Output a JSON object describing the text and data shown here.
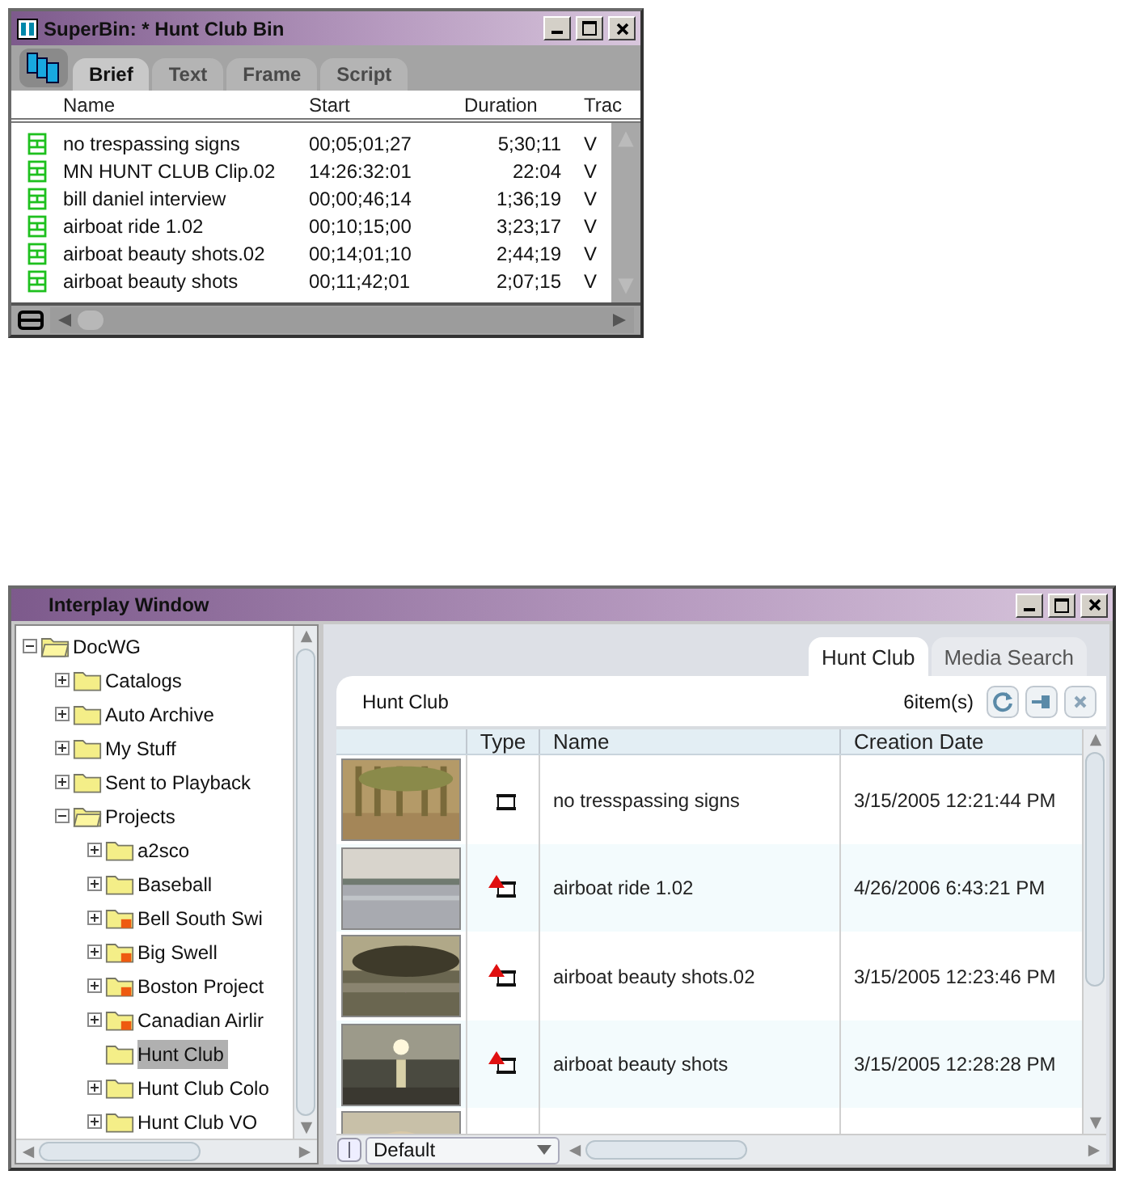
{
  "superbin": {
    "title": "SuperBin: * Hunt Club Bin",
    "tabs": [
      {
        "label": "Brief",
        "selected": true
      },
      {
        "label": "Text",
        "selected": false
      },
      {
        "label": "Frame",
        "selected": false
      },
      {
        "label": "Script",
        "selected": false
      }
    ],
    "columns": [
      "Name",
      "Start",
      "Duration",
      "Trac"
    ],
    "rows": [
      {
        "name": "no trespassing signs",
        "start": "00;05;01;27",
        "duration": "5;30;11",
        "track": "V"
      },
      {
        "name": "MN HUNT CLUB Clip.02",
        "start": "14:26:32:01",
        "duration": "22:04",
        "track": "V"
      },
      {
        "name": "bill daniel interview",
        "start": "00;00;46;14",
        "duration": "1;36;19",
        "track": "V"
      },
      {
        "name": "airboat ride 1.02",
        "start": "00;10;15;00",
        "duration": "3;23;17",
        "track": "V"
      },
      {
        "name": "airboat beauty shots.02",
        "start": "00;14;01;10",
        "duration": "2;44;19",
        "track": "V"
      },
      {
        "name": "airboat beauty shots",
        "start": "00;11;42;01",
        "duration": "2;07;15",
        "track": "V"
      }
    ]
  },
  "interplay": {
    "title": "Interplay Window",
    "tree": [
      {
        "label": "DocWG",
        "expanded": true,
        "selected": false,
        "marked": false,
        "children": [
          {
            "label": "Catalogs",
            "expanded": false,
            "selected": false,
            "marked": false
          },
          {
            "label": "Auto Archive",
            "expanded": false,
            "selected": false,
            "marked": false
          },
          {
            "label": "My Stuff",
            "expanded": false,
            "selected": false,
            "marked": false
          },
          {
            "label": "Sent to Playback",
            "expanded": false,
            "selected": false,
            "marked": false
          },
          {
            "label": "Projects",
            "expanded": true,
            "selected": false,
            "marked": false,
            "children": [
              {
                "label": "a2sco",
                "expanded": false,
                "selected": false,
                "marked": false
              },
              {
                "label": "Baseball",
                "expanded": false,
                "selected": false,
                "marked": false
              },
              {
                "label": "Bell South Swi",
                "expanded": false,
                "selected": false,
                "marked": true
              },
              {
                "label": "Big Swell",
                "expanded": false,
                "selected": false,
                "marked": true
              },
              {
                "label": "Boston Project",
                "expanded": false,
                "selected": false,
                "marked": true
              },
              {
                "label": "Canadian Airlir",
                "expanded": false,
                "selected": false,
                "marked": true
              },
              {
                "label": "Hunt Club",
                "selected": true,
                "marked": false
              },
              {
                "label": "Hunt Club Colo",
                "expanded": false,
                "selected": false,
                "marked": false
              },
              {
                "label": "Hunt Club VO",
                "expanded": false,
                "selected": false,
                "marked": false
              }
            ]
          }
        ]
      }
    ],
    "tabs": [
      {
        "label": "Hunt Club",
        "selected": true
      },
      {
        "label": "Media Search",
        "selected": false
      }
    ],
    "folder_title": "Hunt Club",
    "item_count": "6item(s)",
    "columns": [
      "Type",
      "Name",
      "Creation Date"
    ],
    "rows": [
      {
        "kind": "clip",
        "name": "no tresspassing signs",
        "date": "3/15/2005 12:21:44 PM"
      },
      {
        "kind": "clip_marked",
        "name": "airboat ride 1.02",
        "date": "4/26/2006 6:43:21 PM"
      },
      {
        "kind": "clip_marked",
        "name": "airboat beauty shots.02",
        "date": "3/15/2005 12:23:46 PM"
      },
      {
        "kind": "clip_marked",
        "name": "airboat beauty shots",
        "date": "3/15/2005 12:28:28 PM"
      }
    ],
    "partial_row": {
      "kind": "picture"
    },
    "view": "Default"
  }
}
